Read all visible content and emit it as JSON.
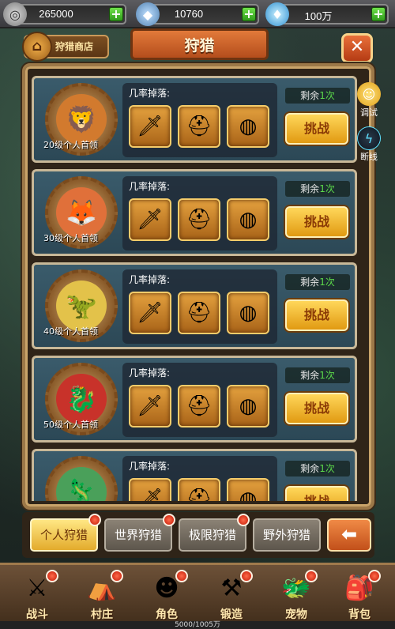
{
  "resources": [
    {
      "icon": "coin-icon",
      "value": "265000"
    },
    {
      "icon": "crystal-icon",
      "value": "10760"
    },
    {
      "icon": "diamond-icon",
      "value": "100万"
    }
  ],
  "header": {
    "title": "狩猎",
    "shop_label": "狩猎商店"
  },
  "side_buttons": [
    {
      "label": "调试"
    },
    {
      "label": "断线"
    }
  ],
  "hunts": [
    {
      "boss_label": "20级个人首领",
      "drop_label": "几率掉落:",
      "remain_prefix": "剩余",
      "remain_count": "1次",
      "challenge_label": "挑战",
      "boss_emoji": "🦁"
    },
    {
      "boss_label": "30级个人首领",
      "drop_label": "几率掉落:",
      "remain_prefix": "剩余",
      "remain_count": "1次",
      "challenge_label": "挑战",
      "boss_emoji": "🦊"
    },
    {
      "boss_label": "40级个人首领",
      "drop_label": "几率掉落:",
      "remain_prefix": "剩余",
      "remain_count": "1次",
      "challenge_label": "挑战",
      "boss_emoji": "🦖"
    },
    {
      "boss_label": "50级个人首领",
      "drop_label": "几率掉落:",
      "remain_prefix": "剩余",
      "remain_count": "1次",
      "challenge_label": "挑战",
      "boss_emoji": "🐉"
    },
    {
      "boss_label": "",
      "drop_label": "几率掉落:",
      "remain_prefix": "剩余",
      "remain_count": "1次",
      "challenge_label": "挑战",
      "boss_emoji": "🦎"
    }
  ],
  "tabs": [
    {
      "label": "个人狩猎",
      "active": true
    },
    {
      "label": "世界狩猎",
      "active": false
    },
    {
      "label": "极限狩猎",
      "active": false
    },
    {
      "label": "野外狩猎",
      "active": false
    }
  ],
  "nav": [
    {
      "label": "战斗",
      "icon": "battle-axe-icon"
    },
    {
      "label": "村庄",
      "icon": "village-hut-icon"
    },
    {
      "label": "角色",
      "icon": "character-icon"
    },
    {
      "label": "锻造",
      "icon": "forge-hammer-icon"
    },
    {
      "label": "宠物",
      "icon": "pet-dragon-icon"
    },
    {
      "label": "背包",
      "icon": "backpack-icon"
    }
  ],
  "exp_text": "5000/1005万"
}
